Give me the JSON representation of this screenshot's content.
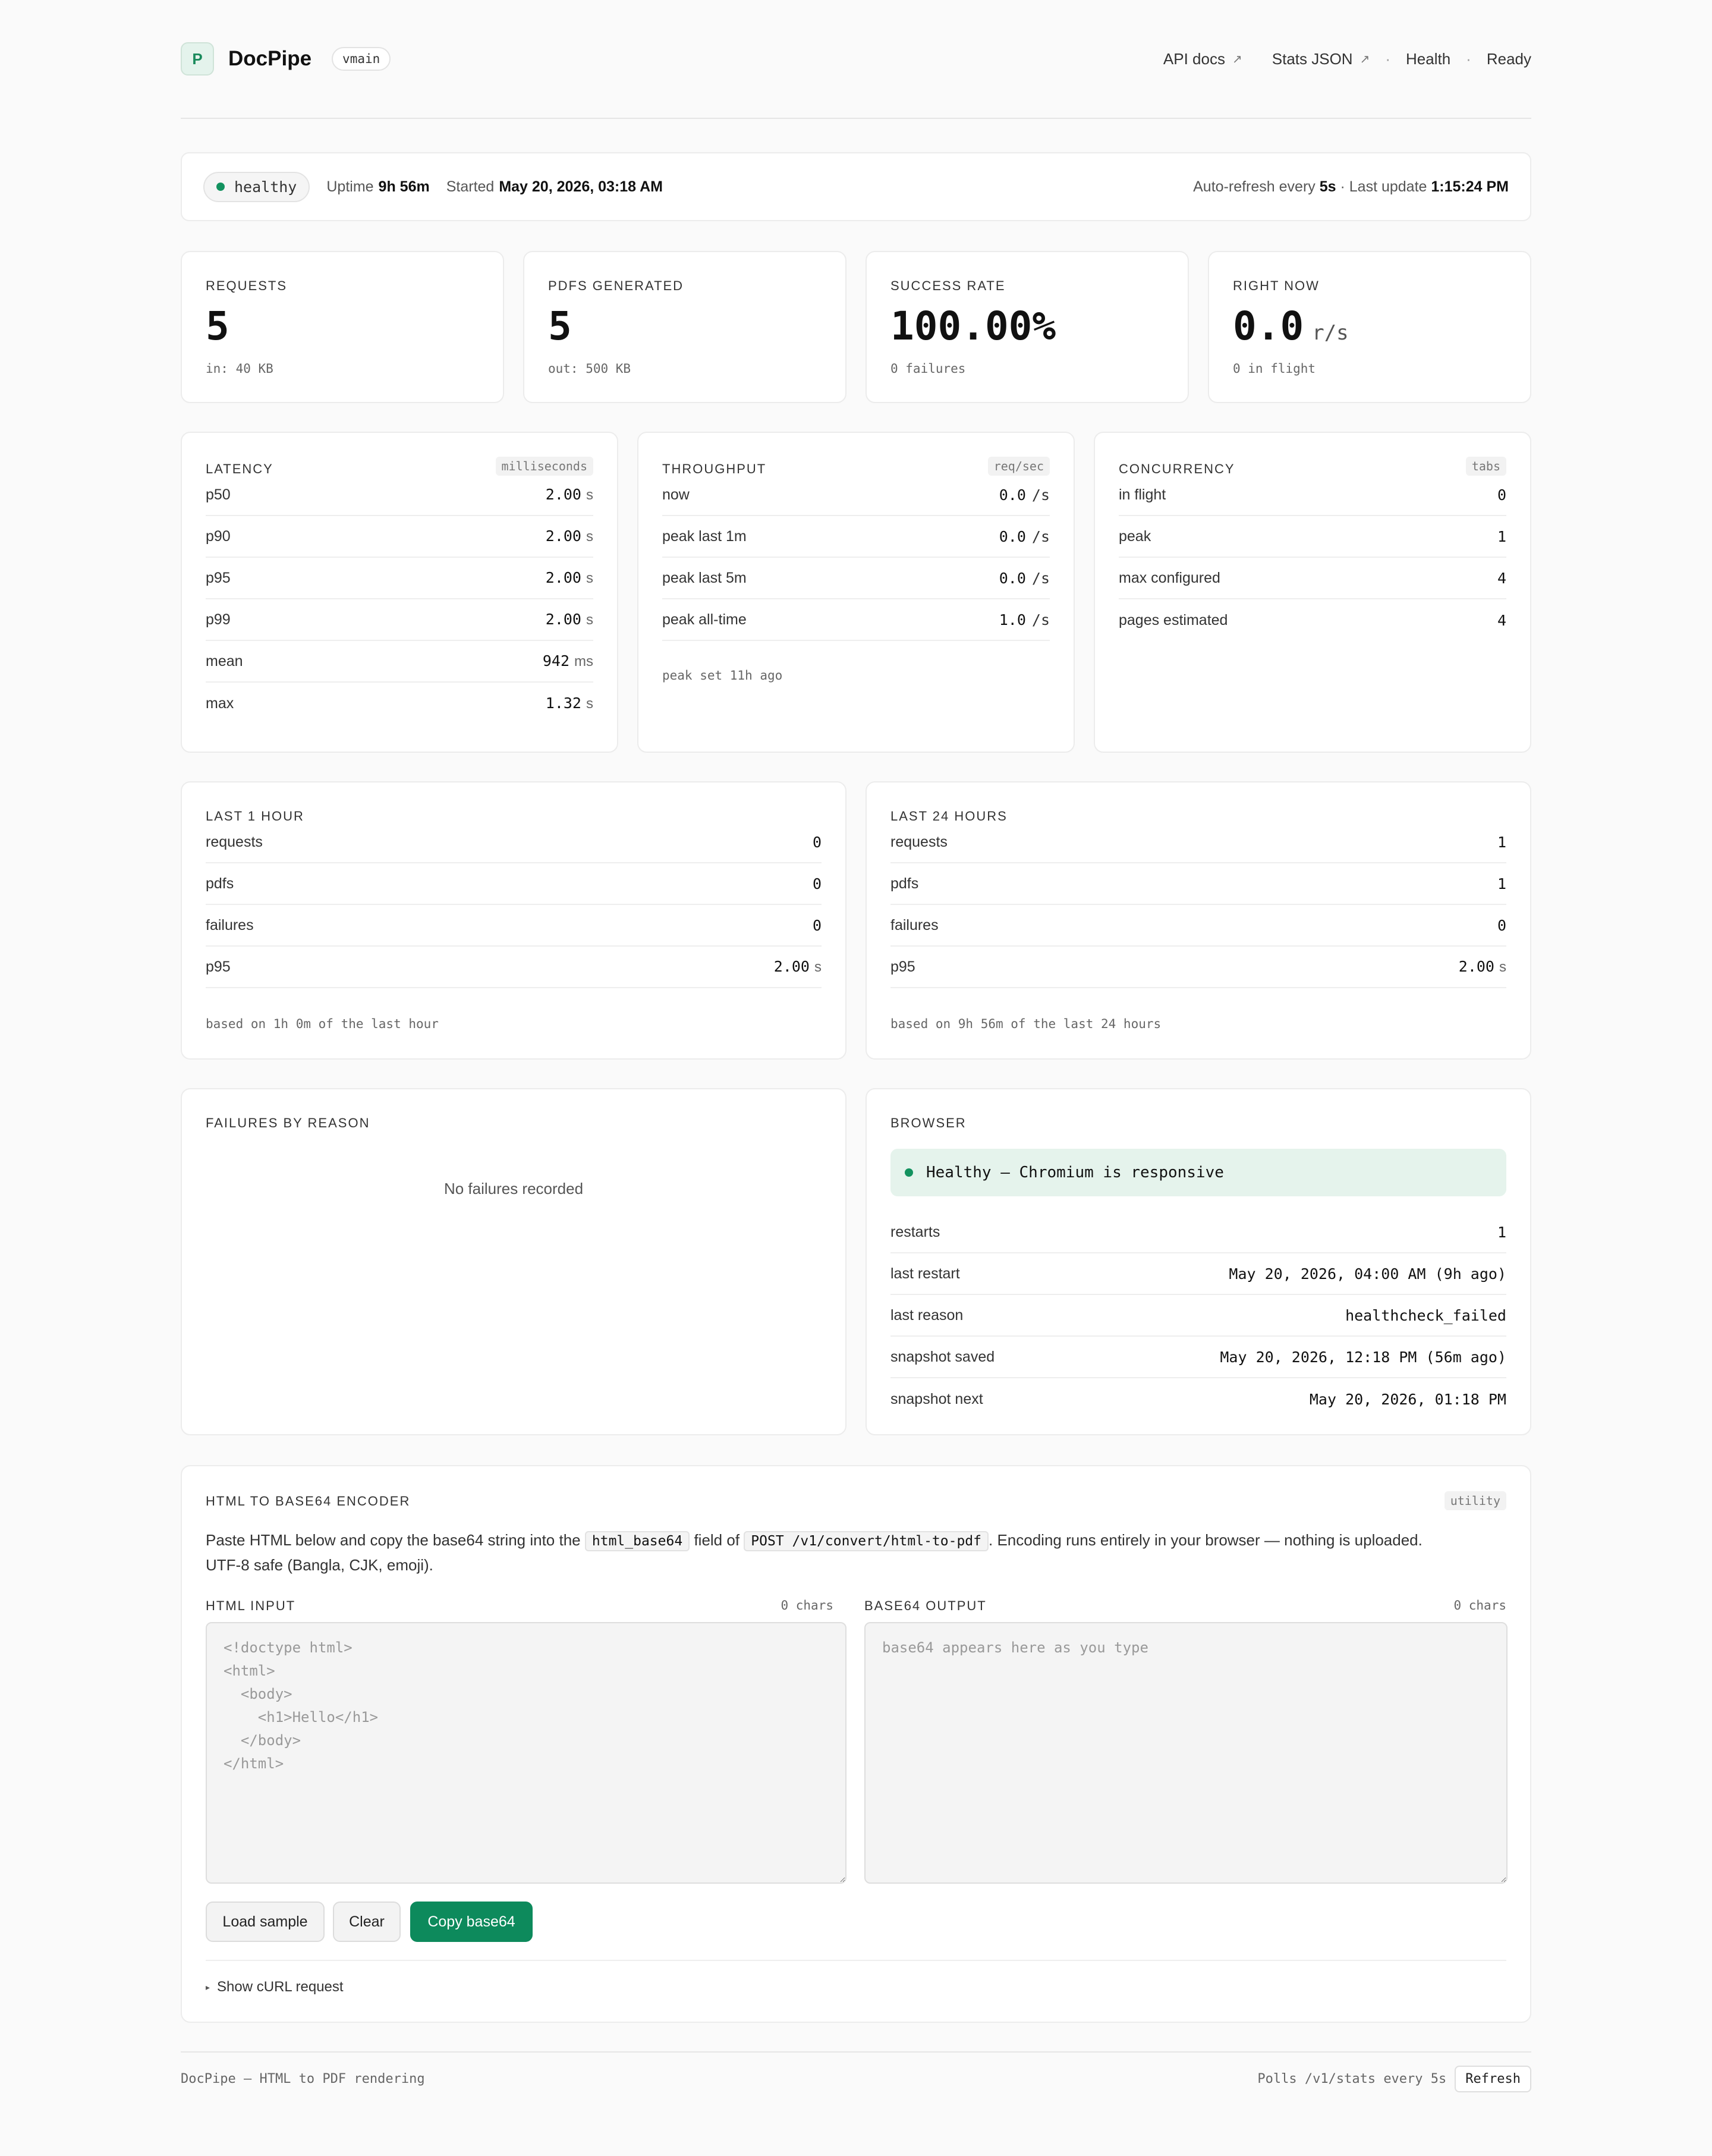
{
  "header": {
    "logo_letter": "P",
    "brand": "DocPipe",
    "branch": "vmain",
    "nav": {
      "api_docs": "API docs",
      "stats_json": "Stats JSON",
      "separator": "·",
      "health": "Health",
      "ready": "Ready"
    }
  },
  "status": {
    "state": "healthy",
    "uptime_label": "Uptime",
    "uptime": "9h 56m",
    "started_label": "Started",
    "started": "May 20, 2026, 03:18 AM",
    "refresh_label": "Auto-refresh every",
    "refresh_interval": "5s",
    "last_update_label": "· Last update",
    "last_update": "1:15:24 PM"
  },
  "kpis": [
    {
      "label": "REQUESTS",
      "value": "5",
      "unit": "",
      "sub": "in: 40 KB"
    },
    {
      "label": "PDFS GENERATED",
      "value": "5",
      "unit": "",
      "sub": "out: 500 KB"
    },
    {
      "label": "SUCCESS RATE",
      "value": "100.00%",
      "unit": "",
      "sub": "0 failures"
    },
    {
      "label": "RIGHT NOW",
      "value": "0.0",
      "unit": "r/s",
      "sub": "0 in flight"
    }
  ],
  "latency": {
    "title": "LATENCY",
    "tag": "milliseconds",
    "rows": [
      {
        "k": "p50",
        "v": "2.00",
        "u": "s"
      },
      {
        "k": "p90",
        "v": "2.00",
        "u": "s"
      },
      {
        "k": "p95",
        "v": "2.00",
        "u": "s"
      },
      {
        "k": "p99",
        "v": "2.00",
        "u": "s"
      },
      {
        "k": "mean",
        "v": "942",
        "u": "ms"
      },
      {
        "k": "max",
        "v": "1.32",
        "u": "s"
      }
    ]
  },
  "throughput": {
    "title": "THROUGHPUT",
    "tag": "req/sec",
    "rows": [
      {
        "k": "now",
        "v": "0.0",
        "u": "/s"
      },
      {
        "k": "peak last 1m",
        "v": "0.0",
        "u": "/s"
      },
      {
        "k": "peak last 5m",
        "v": "0.0",
        "u": "/s"
      },
      {
        "k": "peak all-time",
        "v": "1.0",
        "u": "/s"
      }
    ],
    "note": "peak set 11h ago"
  },
  "concurrency": {
    "title": "CONCURRENCY",
    "tag": "tabs",
    "rows": [
      {
        "k": "in flight",
        "v": "0"
      },
      {
        "k": "peak",
        "v": "1"
      },
      {
        "k": "max configured",
        "v": "4"
      },
      {
        "k": "pages estimated",
        "v": "4"
      }
    ]
  },
  "last_hour": {
    "title": "LAST 1 HOUR",
    "rows": [
      {
        "k": "requests",
        "v": "0"
      },
      {
        "k": "pdfs",
        "v": "0"
      },
      {
        "k": "failures",
        "v": "0"
      },
      {
        "k": "p95",
        "v": "2.00",
        "u": "s"
      }
    ],
    "note": "based on 1h 0m of the last hour"
  },
  "last_day": {
    "title": "LAST 24 HOURS",
    "rows": [
      {
        "k": "requests",
        "v": "1"
      },
      {
        "k": "pdfs",
        "v": "1"
      },
      {
        "k": "failures",
        "v": "0"
      },
      {
        "k": "p95",
        "v": "2.00",
        "u": "s"
      }
    ],
    "note": "based on 9h 56m of the last 24 hours"
  },
  "failures": {
    "title": "FAILURES BY REASON",
    "empty": "No failures recorded"
  },
  "browser": {
    "title": "BROWSER",
    "banner": "Healthy — Chromium is responsive",
    "rows": [
      {
        "k": "restarts",
        "v": "1"
      },
      {
        "k": "last restart",
        "v": "May 20, 2026, 04:00 AM (9h ago)"
      },
      {
        "k": "last reason",
        "v": "healthcheck_failed"
      },
      {
        "k": "snapshot saved",
        "v": "May 20, 2026, 12:18 PM (56m ago)"
      },
      {
        "k": "snapshot next",
        "v": "May 20, 2026, 01:18 PM"
      }
    ]
  },
  "encoder": {
    "title": "HTML TO BASE64 ENCODER",
    "tag": "utility",
    "desc_1": "Paste HTML below and copy the base64 string into the",
    "code_1": "html_base64",
    "desc_2": "field of",
    "code_2": "POST /v1/convert/html-to-pdf",
    "desc_3": ". Encoding runs entirely in your browser — nothing is uploaded.",
    "desc_4": "UTF-8 safe (Bangla, CJK, emoji).",
    "input_label": "HTML INPUT",
    "input_count": "0 chars",
    "input_placeholder": "<!doctype html>\n<html>\n  <body>\n    <h1>Hello</h1>\n  </body>\n</html>",
    "output_label": "BASE64 OUTPUT",
    "output_count": "0 chars",
    "output_placeholder": "base64 appears here as you type",
    "btn_load": "Load sample",
    "btn_clear": "Clear",
    "btn_copy": "Copy base64",
    "curl_toggle": "Show cURL request",
    "curl_marker": "▸"
  },
  "footer": {
    "left": "DocPipe — HTML to PDF rendering",
    "polls": "Polls /v1/stats every 5s",
    "refresh": "Refresh"
  },
  "colors": {
    "accent": "#0d8a5c",
    "healthy_dot": "#13925f",
    "banner_bg": "#e5f3ec"
  }
}
